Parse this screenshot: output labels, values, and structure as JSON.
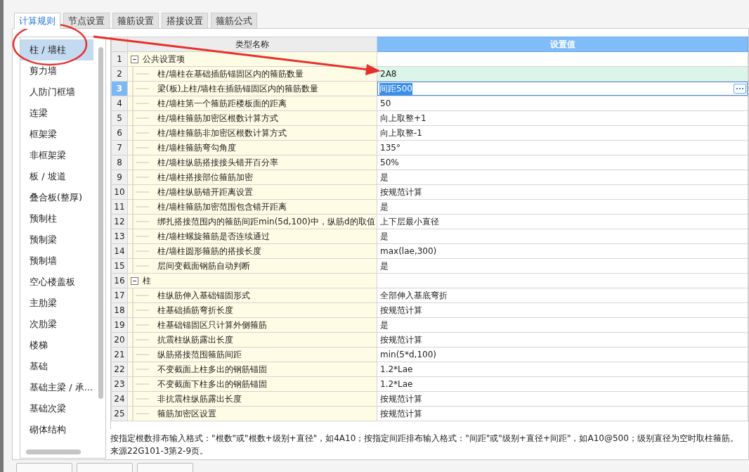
{
  "tabs": [
    {
      "label": "计算规则",
      "selected": true
    },
    {
      "label": "节点设置",
      "selected": false
    },
    {
      "label": "箍筋设置",
      "selected": false
    },
    {
      "label": "搭接设置",
      "selected": false
    },
    {
      "label": "箍筋公式",
      "selected": false
    }
  ],
  "sidebar": {
    "items": [
      {
        "label": "柱 / 墙柱",
        "selected": true
      },
      {
        "label": "剪力墙",
        "selected": false
      },
      {
        "label": "人防门框墙",
        "selected": false
      },
      {
        "label": "连梁",
        "selected": false
      },
      {
        "label": "框架梁",
        "selected": false
      },
      {
        "label": "非框架梁",
        "selected": false
      },
      {
        "label": "板 / 坡道",
        "selected": false
      },
      {
        "label": "叠合板(整厚)",
        "selected": false
      },
      {
        "label": "预制柱",
        "selected": false
      },
      {
        "label": "预制梁",
        "selected": false
      },
      {
        "label": "预制墙",
        "selected": false
      },
      {
        "label": "空心楼盖板",
        "selected": false
      },
      {
        "label": "主肋梁",
        "selected": false
      },
      {
        "label": "次肋梁",
        "selected": false
      },
      {
        "label": "楼梯",
        "selected": false
      },
      {
        "label": "基础",
        "selected": false
      },
      {
        "label": "基础主梁 / 承...",
        "selected": false
      },
      {
        "label": "基础次梁",
        "selected": false
      },
      {
        "label": "砌体结构",
        "selected": false
      }
    ]
  },
  "table": {
    "columns": [
      "类型名称",
      "设置值"
    ],
    "rows": [
      {
        "num": "1",
        "kind": "group",
        "expanded": true,
        "name": "公共设置项",
        "value": "",
        "selected": false,
        "hovered": false
      },
      {
        "num": "2",
        "kind": "item",
        "name": "柱/墙柱在基础插筋锚固区内的箍筋数量",
        "value": "2A8",
        "selected": false,
        "hovered": true
      },
      {
        "num": "3",
        "kind": "item",
        "name": "梁(板)上柱/墙柱在插筋锚固区内的箍筋数量",
        "value": "间距500",
        "selected": true,
        "hovered": false
      },
      {
        "num": "4",
        "kind": "item",
        "name": "柱/墙柱第一个箍筋距楼板面的距离",
        "value": "50",
        "selected": false,
        "hovered": false
      },
      {
        "num": "5",
        "kind": "item",
        "name": "柱/墙柱箍筋加密区根数计算方式",
        "value": "向上取整+1",
        "selected": false,
        "hovered": false
      },
      {
        "num": "6",
        "kind": "item",
        "name": "柱/墙柱箍筋非加密区根数计算方式",
        "value": "向上取整-1",
        "selected": false,
        "hovered": false
      },
      {
        "num": "7",
        "kind": "item",
        "name": "柱/墙柱箍筋弯勾角度",
        "value": "135°",
        "selected": false,
        "hovered": false
      },
      {
        "num": "8",
        "kind": "item",
        "name": "柱/墙柱纵筋搭接接头错开百分率",
        "value": "50%",
        "selected": false,
        "hovered": false
      },
      {
        "num": "9",
        "kind": "item",
        "name": "柱/墙柱搭接部位箍筋加密",
        "value": "是",
        "selected": false,
        "hovered": false
      },
      {
        "num": "10",
        "kind": "item",
        "name": "柱/墙柱纵筋错开距离设置",
        "value": "按规范计算",
        "selected": false,
        "hovered": false
      },
      {
        "num": "11",
        "kind": "item",
        "name": "柱/墙柱箍筋加密范围包含错开距离",
        "value": "是",
        "selected": false,
        "hovered": false
      },
      {
        "num": "12",
        "kind": "item",
        "name": "绑扎搭接范围内的箍筋间距min(5d,100)中，纵筋d的取值",
        "value": "上下层最小直径",
        "selected": false,
        "hovered": false
      },
      {
        "num": "13",
        "kind": "item",
        "name": "柱/墙柱螺旋箍筋是否连续通过",
        "value": "是",
        "selected": false,
        "hovered": false
      },
      {
        "num": "14",
        "kind": "item",
        "name": "柱/墙柱圆形箍筋的搭接长度",
        "value": "max(lae,300)",
        "selected": false,
        "hovered": false
      },
      {
        "num": "15",
        "kind": "item",
        "name": "层间变截面钢筋自动判断",
        "value": "是",
        "selected": false,
        "hovered": false
      },
      {
        "num": "16",
        "kind": "group",
        "expanded": true,
        "name": "柱",
        "value": "",
        "selected": false,
        "hovered": false
      },
      {
        "num": "17",
        "kind": "item",
        "name": "柱纵筋伸入基础锚固形式",
        "value": "全部伸入基底弯折",
        "selected": false,
        "hovered": false
      },
      {
        "num": "18",
        "kind": "item",
        "name": "柱基础插筋弯折长度",
        "value": "按规范计算",
        "selected": false,
        "hovered": false
      },
      {
        "num": "19",
        "kind": "item",
        "name": "柱基础锚固区只计算外侧箍筋",
        "value": "是",
        "selected": false,
        "hovered": false
      },
      {
        "num": "20",
        "kind": "item",
        "name": "抗震柱纵筋露出长度",
        "value": "按规范计算",
        "selected": false,
        "hovered": false
      },
      {
        "num": "21",
        "kind": "item",
        "name": "纵筋搭接范围箍筋间距",
        "value": "min(5*d,100)",
        "selected": false,
        "hovered": false
      },
      {
        "num": "22",
        "kind": "item",
        "name": "不变截面上柱多出的钢筋锚固",
        "value": "1.2*Lae",
        "selected": false,
        "hovered": false
      },
      {
        "num": "23",
        "kind": "item",
        "name": "不变截面下柱多出的钢筋锚固",
        "value": "1.2*Lae",
        "selected": false,
        "hovered": false
      },
      {
        "num": "24",
        "kind": "item",
        "name": "非抗震柱纵筋露出长度",
        "value": "按规范计算",
        "selected": false,
        "hovered": false
      },
      {
        "num": "25",
        "kind": "item",
        "name": "箍筋加密区设置",
        "value": "按规范计算",
        "selected": false,
        "hovered": false
      }
    ]
  },
  "note": "按指定根数排布输入格式：\"根数\"或\"根数+级别+直径\"，如4A10；按指定间距排布输入格式：\"间距\"或\"级别+直径+间距\"，如A10@500；级别直径为空时取柱箍筋。来源22G101-3第2-9页。"
}
